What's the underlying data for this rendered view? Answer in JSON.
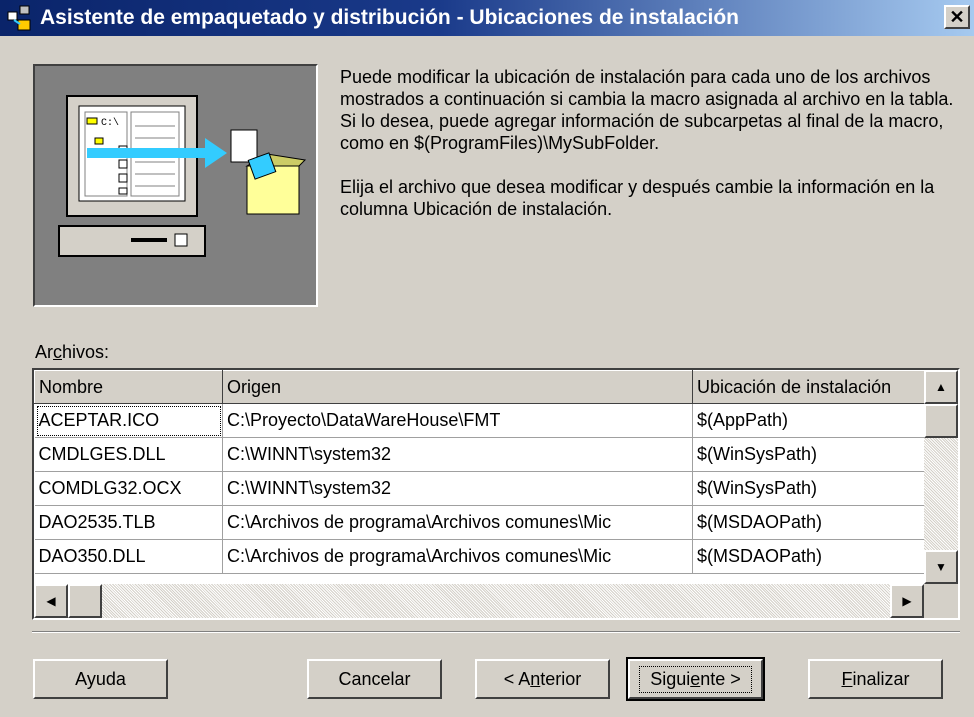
{
  "window": {
    "title": "Asistente de empaquetado y distribución - Ubicaciones de instalación",
    "close_glyph": "✕"
  },
  "description": {
    "para1": "Puede modificar la ubicación de instalación para cada uno de los archivos mostrados a continuación si cambia la macro asignada al archivo en la tabla. Si lo desea, puede agregar información de subcarpetas al final de la macro, como en $(ProgramFiles)\\MySubFolder.",
    "para2": "Elija el archivo que desea modificar y después cambie la información en la columna Ubicación de instalación."
  },
  "files": {
    "label_pre": "Ar",
    "label_accel": "c",
    "label_post": "hivos:",
    "columns": [
      "Nombre",
      "Origen",
      "Ubicación de instalación"
    ],
    "rows": [
      {
        "name": "ACEPTAR.ICO",
        "origin": "C:\\Proyecto\\DataWareHouse\\FMT",
        "location": "$(AppPath)"
      },
      {
        "name": "CMDLGES.DLL",
        "origin": "C:\\WINNT\\system32",
        "location": "$(WinSysPath)"
      },
      {
        "name": "COMDLG32.OCX",
        "origin": "C:\\WINNT\\system32",
        "location": "$(WinSysPath)"
      },
      {
        "name": "DAO2535.TLB",
        "origin": "C:\\Archivos de programa\\Archivos comunes\\Mic",
        "location": "$(MSDAOPath)"
      },
      {
        "name": "DAO350.DLL",
        "origin": "C:\\Archivos de programa\\Archivos comunes\\Mic",
        "location": "$(MSDAOPath)"
      }
    ],
    "selected_row": 0
  },
  "buttons": {
    "help": "Ayuda",
    "cancel": "Cancelar",
    "back": {
      "pre": "< A",
      "accel": "n",
      "post": "terior"
    },
    "next": {
      "pre": "Sigui",
      "accel": "e",
      "post": "nte >"
    },
    "finish": {
      "pre": "",
      "accel": "F",
      "post": "inalizar"
    }
  },
  "colors": {
    "titlebar_start": "#0a246a",
    "titlebar_end": "#a6caf0",
    "dialog_bg": "#d4d0c8",
    "highlight_arrow": "#33ccff"
  }
}
